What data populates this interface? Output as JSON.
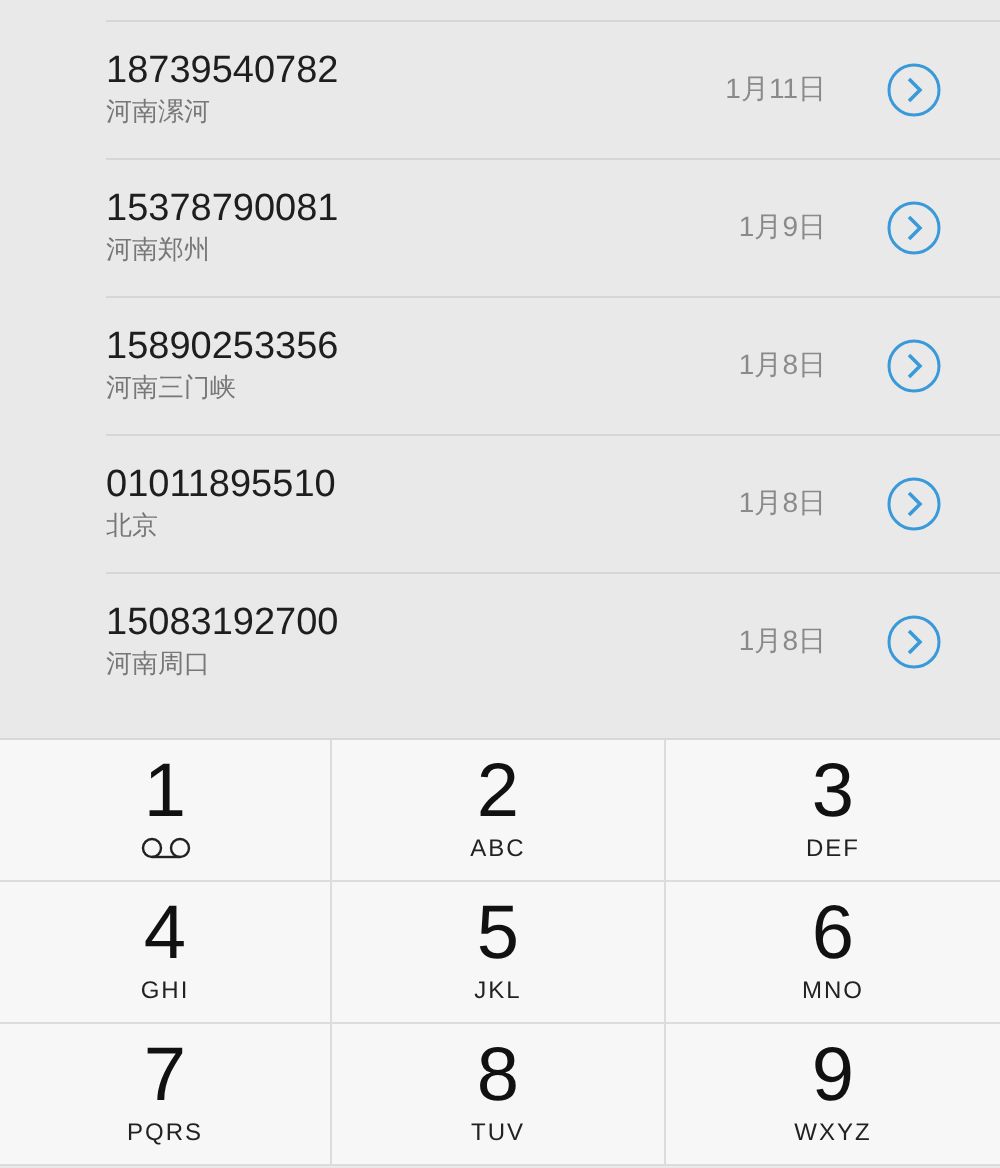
{
  "recents": [
    {
      "number": "18739540782",
      "location": "河南漯河",
      "date": "1月11日"
    },
    {
      "number": "15378790081",
      "location": "河南郑州",
      "date": "1月9日"
    },
    {
      "number": "15890253356",
      "location": "河南三门峡",
      "date": "1月8日"
    },
    {
      "number": "01011895510",
      "location": "北京",
      "date": "1月8日"
    },
    {
      "number": "15083192700",
      "location": "河南周口",
      "date": "1月8日"
    }
  ],
  "keypad": [
    {
      "kind": "voicemail",
      "digit": "1"
    },
    {
      "kind": "letters",
      "digit": "2",
      "letters": "ABC"
    },
    {
      "kind": "letters",
      "digit": "3",
      "letters": "DEF"
    },
    {
      "kind": "letters",
      "digit": "4",
      "letters": "GHI"
    },
    {
      "kind": "letters",
      "digit": "5",
      "letters": "JKL"
    },
    {
      "kind": "letters",
      "digit": "6",
      "letters": "MNO"
    },
    {
      "kind": "letters",
      "digit": "7",
      "letters": "PQRS"
    },
    {
      "kind": "letters",
      "digit": "8",
      "letters": "TUV"
    },
    {
      "kind": "letters",
      "digit": "9",
      "letters": "WXYZ"
    }
  ]
}
